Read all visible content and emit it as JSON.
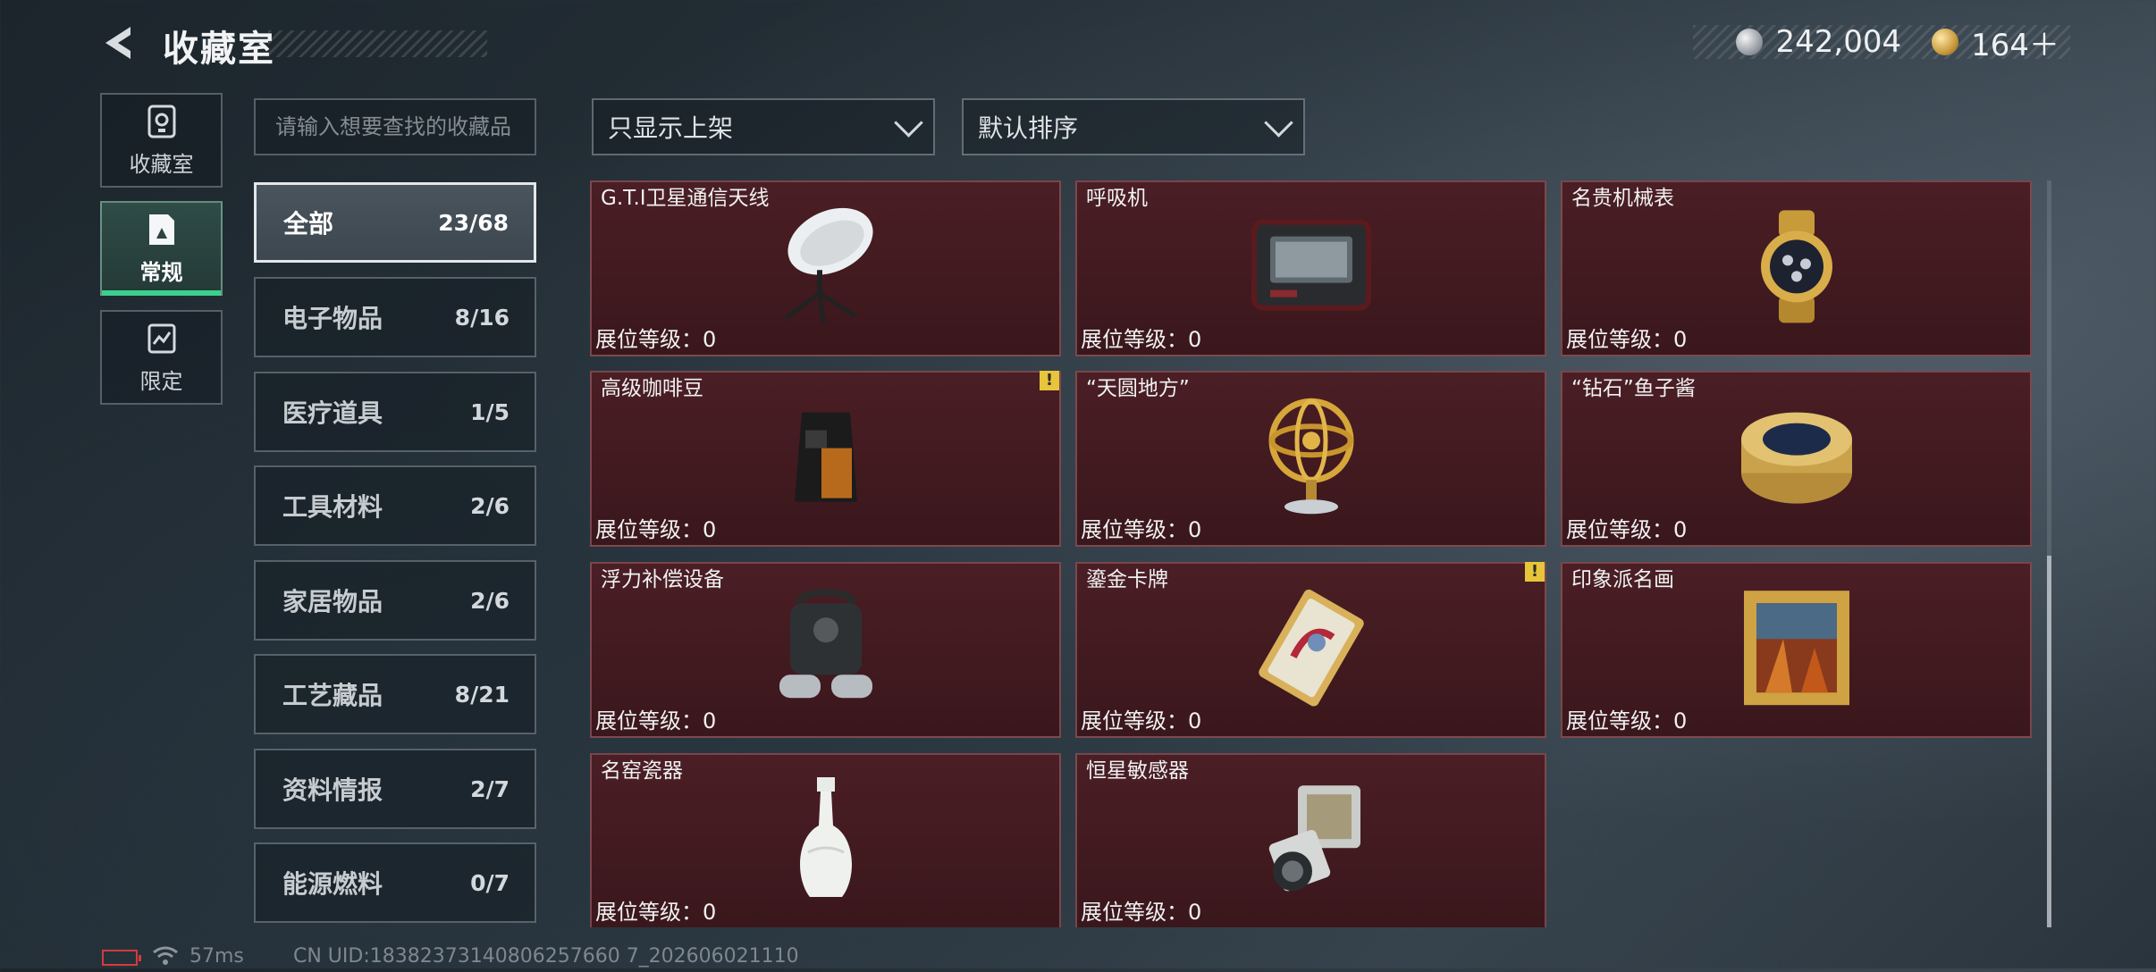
{
  "header": {
    "title": "收藏室",
    "currency": [
      {
        "icon": "silver-coin-icon",
        "value": "242,004"
      },
      {
        "icon": "gold-coin-icon",
        "value": "164＋"
      }
    ]
  },
  "sidetabs": [
    {
      "label": "收藏室",
      "icon": "collection-icon",
      "active": false
    },
    {
      "label": "常规",
      "icon": "regular-icon",
      "active": true
    },
    {
      "label": "限定",
      "icon": "limited-icon",
      "active": false
    }
  ],
  "search": {
    "placeholder": "请输入想要查找的收藏品"
  },
  "filters": {
    "filter_label": "只显示上架",
    "sort_label": "默认排序"
  },
  "categories": [
    {
      "name": "全部",
      "count": "23/68",
      "active": true
    },
    {
      "name": "电子物品",
      "count": "8/16"
    },
    {
      "name": "医疗道具",
      "count": "1/5"
    },
    {
      "name": "工具材料",
      "count": "2/6"
    },
    {
      "name": "家居物品",
      "count": "2/6"
    },
    {
      "name": "工艺藏品",
      "count": "8/21"
    },
    {
      "name": "资料情报",
      "count": "2/7"
    },
    {
      "name": "能源燃料",
      "count": "0/7"
    }
  ],
  "items": [
    {
      "name": "G.T.I卫星通信天线",
      "level": "展位等级：0",
      "icon": "satellite-dish-icon"
    },
    {
      "name": "呼吸机",
      "level": "展位等级：0",
      "icon": "ventilator-icon"
    },
    {
      "name": "名贵机械表",
      "level": "展位等级：0",
      "icon": "watch-icon"
    },
    {
      "name": "高级咖啡豆",
      "level": "展位等级：0",
      "icon": "coffee-bag-icon",
      "alert": "!"
    },
    {
      "name": "“天圆地方”",
      "level": "展位等级：0",
      "icon": "armillary-sphere-icon"
    },
    {
      "name": "“钻石”鱼子酱",
      "level": "展位等级：0",
      "icon": "caviar-tin-icon"
    },
    {
      "name": "浮力补偿设备",
      "level": "展位等级：0",
      "icon": "diving-tank-icon"
    },
    {
      "name": "鎏金卡牌",
      "level": "展位等级：0",
      "icon": "gilded-card-icon",
      "alert": "!"
    },
    {
      "name": "印象派名画",
      "level": "展位等级：0",
      "icon": "framed-painting-icon"
    },
    {
      "name": "名窑瓷器",
      "level": "展位等级：0",
      "icon": "porcelain-vase-icon"
    },
    {
      "name": "恒星敏感器",
      "level": "展位等级：0",
      "icon": "star-sensor-icon"
    }
  ],
  "footer": {
    "ping": "57ms",
    "uid": "CN UID:18382373140806257660 7_202606021110"
  },
  "colors": {
    "accent_green": "#3bd08d",
    "card_bg": "#4a1e24",
    "alert_yellow": "#e7c43a"
  }
}
